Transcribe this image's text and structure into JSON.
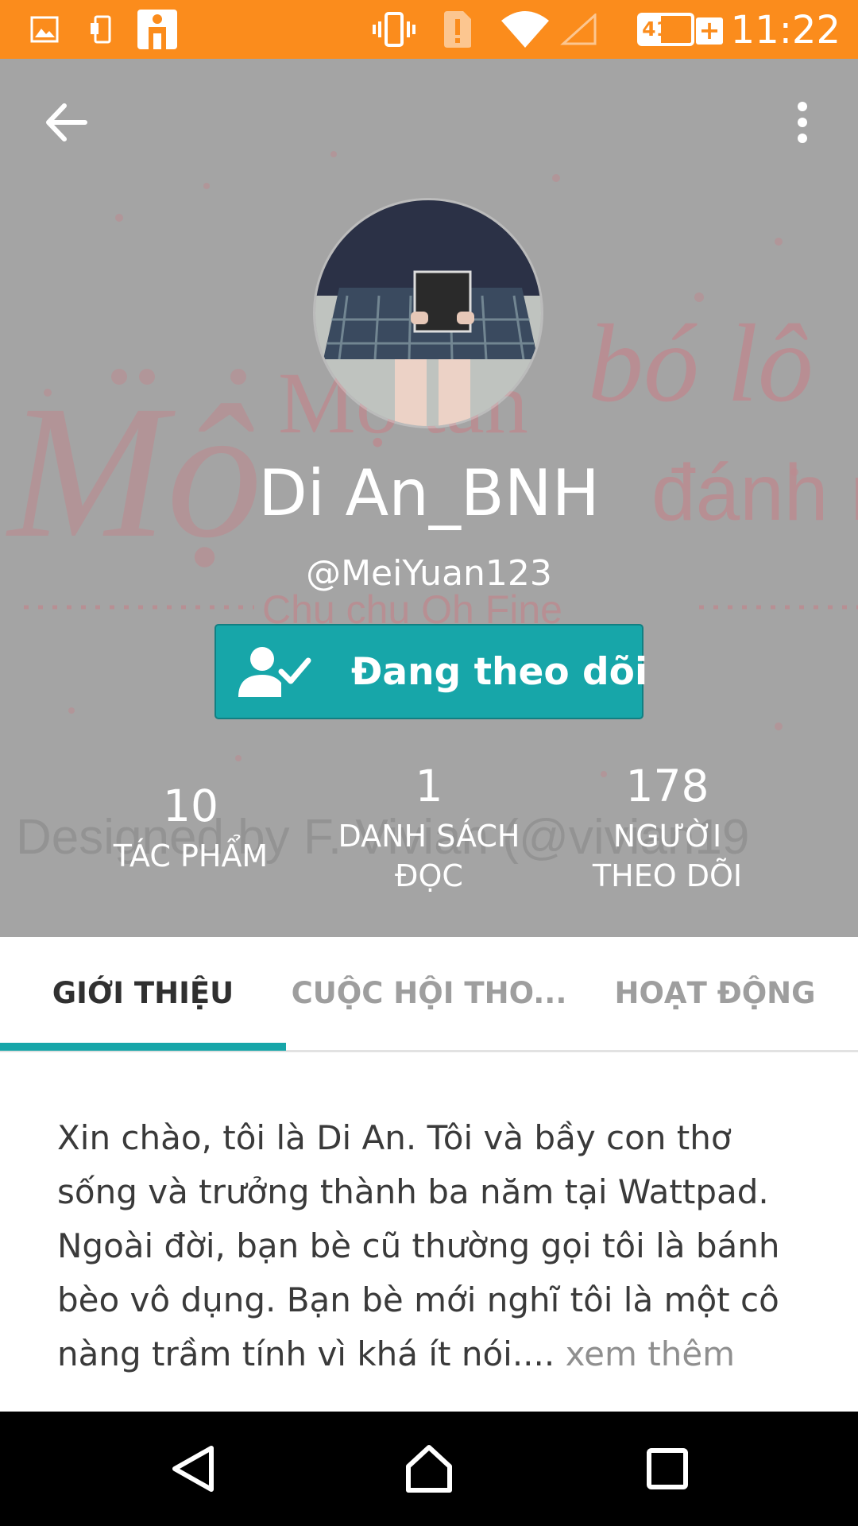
{
  "status_bar": {
    "time": "11:22",
    "battery_percent": "41%",
    "battery_level": 0.41,
    "icons": [
      "image-icon",
      "phone-transfer-icon",
      "app-icon",
      "vibrate-icon",
      "alert-sim-icon",
      "wifi-icon",
      "cell-signal-icon",
      "battery-icon",
      "charging-plus-icon"
    ],
    "background_color": "#fb8c1c"
  },
  "header": {
    "back_icon": "arrow-left-icon",
    "menu_icon": "more-vertical-icon",
    "display_name": "Di An_BNH",
    "username": "@MeiYuan123",
    "follow_button": {
      "label": "Đang theo dõi",
      "icon": "user-check-icon",
      "color": "#17a6a9"
    },
    "stats": [
      {
        "value": "10",
        "label": "TÁC PHẨM"
      },
      {
        "value": "1",
        "label": "DANH SÁCH ĐỌC"
      },
      {
        "value": "178",
        "label": "NGƯỜI THEO DÕI"
      }
    ],
    "cover_text": [
      "Một bó lô",
      "Mộ tấn đánh ra",
      "Chu chu Oh Fine",
      "Designed by F. Vivian (@vivian19"
    ]
  },
  "tabs": {
    "items": [
      {
        "label": "GIỚI THIỆU",
        "active": true
      },
      {
        "label": "CUỘC HỘI THO...",
        "active": false
      },
      {
        "label": "HOẠT ĐỘNG",
        "active": false
      }
    ],
    "accent_color": "#17a6a9"
  },
  "about": {
    "text": "Xin chào, tôi là Di An. Tôi và bầy con thơ sống và trưởng thành ba năm tại Wattpad. Ngoài đời, bạn bè cũ thường gọi tôi là bánh bèo vô dụng. Bạn bè mới nghĩ tôi là một cô nàng trầm tính vì khá ít nói....",
    "more_label": " xem thêm"
  },
  "nav_bar": {
    "icons": [
      "back-triangle-icon",
      "home-icon",
      "recents-icon"
    ]
  }
}
